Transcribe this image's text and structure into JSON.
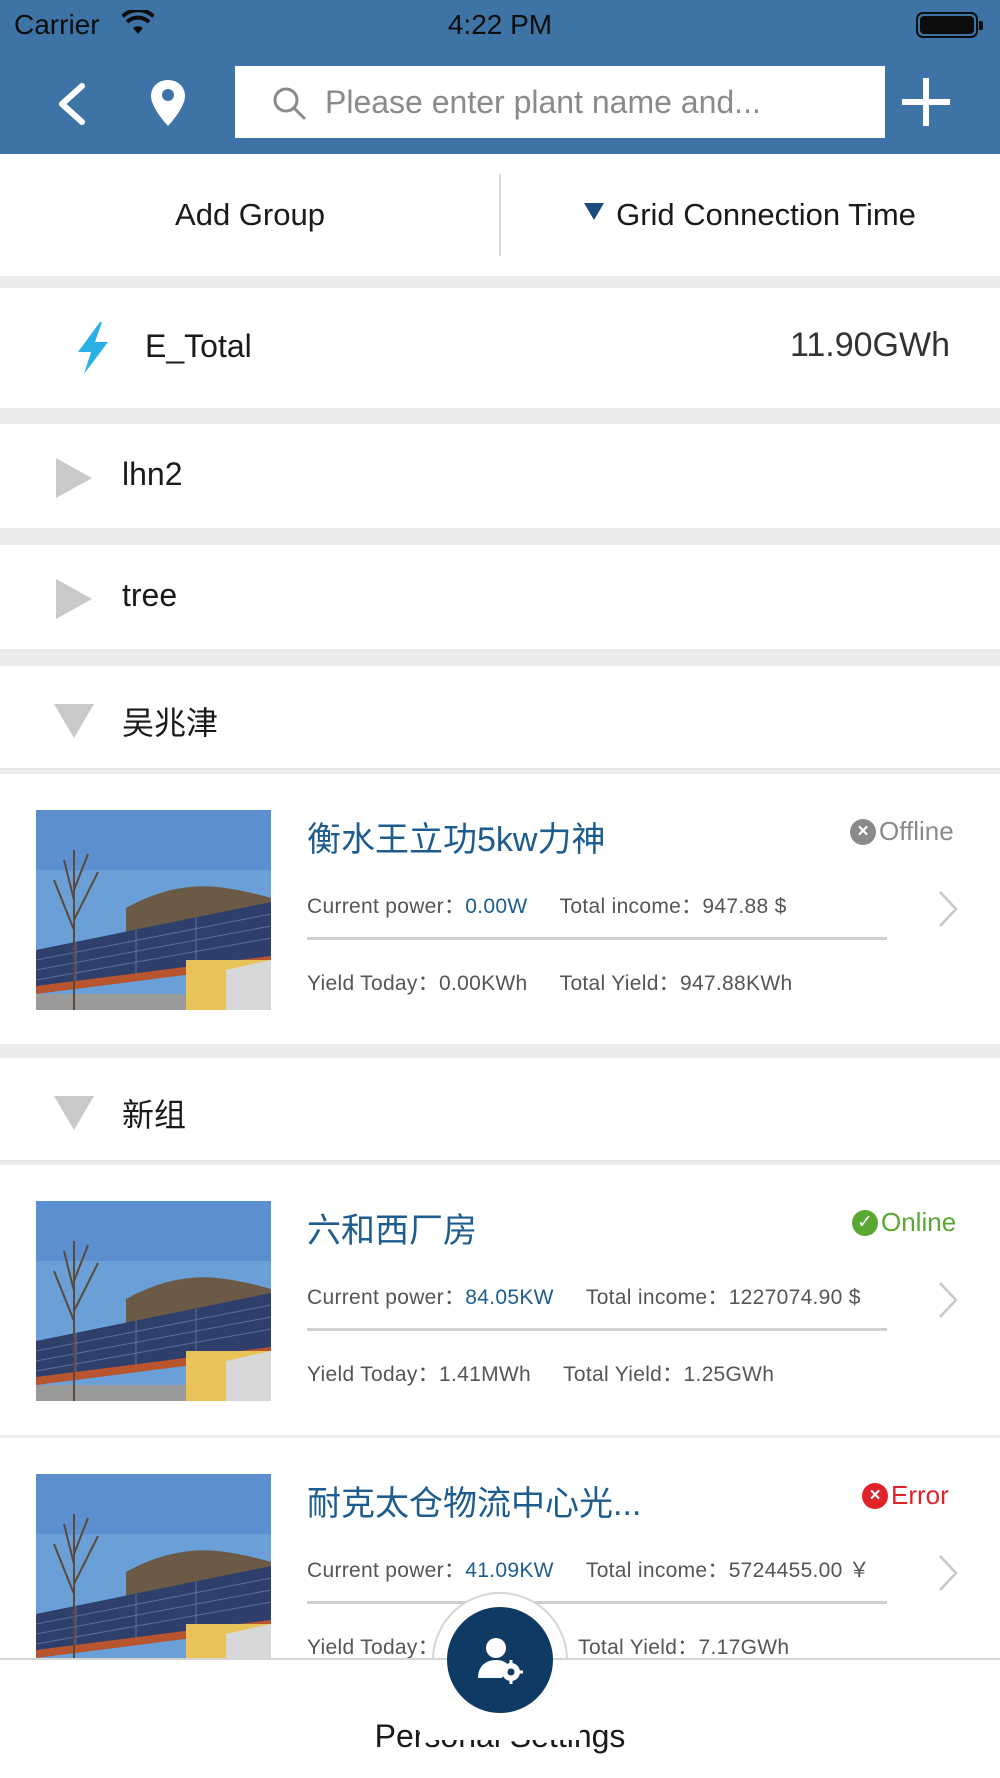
{
  "status_bar": {
    "carrier": "Carrier",
    "time": "4:22 PM"
  },
  "nav": {
    "search_placeholder": "Please enter plant name and...",
    "icons": {
      "back": "back-chevron-icon",
      "location": "location-pin-icon",
      "search": "search-icon",
      "add": "plus-icon"
    }
  },
  "filters": {
    "add_group": "Add Group",
    "sort_label": "Grid Connection Time"
  },
  "total": {
    "label": "E_Total",
    "value": "11.90GWh",
    "icon": "lightning-bolt-icon"
  },
  "groups": [
    {
      "name": "lhn2",
      "expanded": false
    },
    {
      "name": "tree",
      "expanded": false
    },
    {
      "name": "吴兆津",
      "expanded": true
    },
    {
      "name": "新组",
      "expanded": true
    }
  ],
  "plants": [
    {
      "name": "衡水王立功5kw力神",
      "status": "Offline",
      "status_color": "#8a8a8a",
      "current_power_label": "Current power：",
      "current_power": "0.00W",
      "total_income_label": "Total income：",
      "total_income": "947.88 $",
      "yield_today_label": "Yield Today：",
      "yield_today": "0.00KWh",
      "total_yield_label": "Total Yield：",
      "total_yield": "947.88KWh"
    },
    {
      "name": "六和西厂房",
      "status": "Online",
      "status_color": "#5aa832",
      "current_power_label": "Current power：",
      "current_power": "84.05KW",
      "total_income_label": "Total income：",
      "total_income": "1227074.90 $",
      "yield_today_label": "Yield Today：",
      "yield_today": "1.41MWh",
      "total_yield_label": "Total Yield：",
      "total_yield": "1.25GWh"
    },
    {
      "name": "耐克太仓物流中心光...",
      "status": "Error",
      "status_color": "#e0222a",
      "current_power_label": "Current power：",
      "current_power": "41.09KW",
      "total_income_label": "Total income：",
      "total_income": "5724455.00 ￥",
      "yield_today_label": "Yield Today：",
      "yield_today": "",
      "total_yield_label": "Total Yield：",
      "total_yield": "7.17GWh"
    }
  ],
  "tab_bar": {
    "label": "Personal Settings",
    "icon": "user-settings-icon"
  },
  "colors": {
    "header": "#3d74a5",
    "accent_dark": "#0f3a63",
    "link_blue": "#1d5c8f"
  }
}
